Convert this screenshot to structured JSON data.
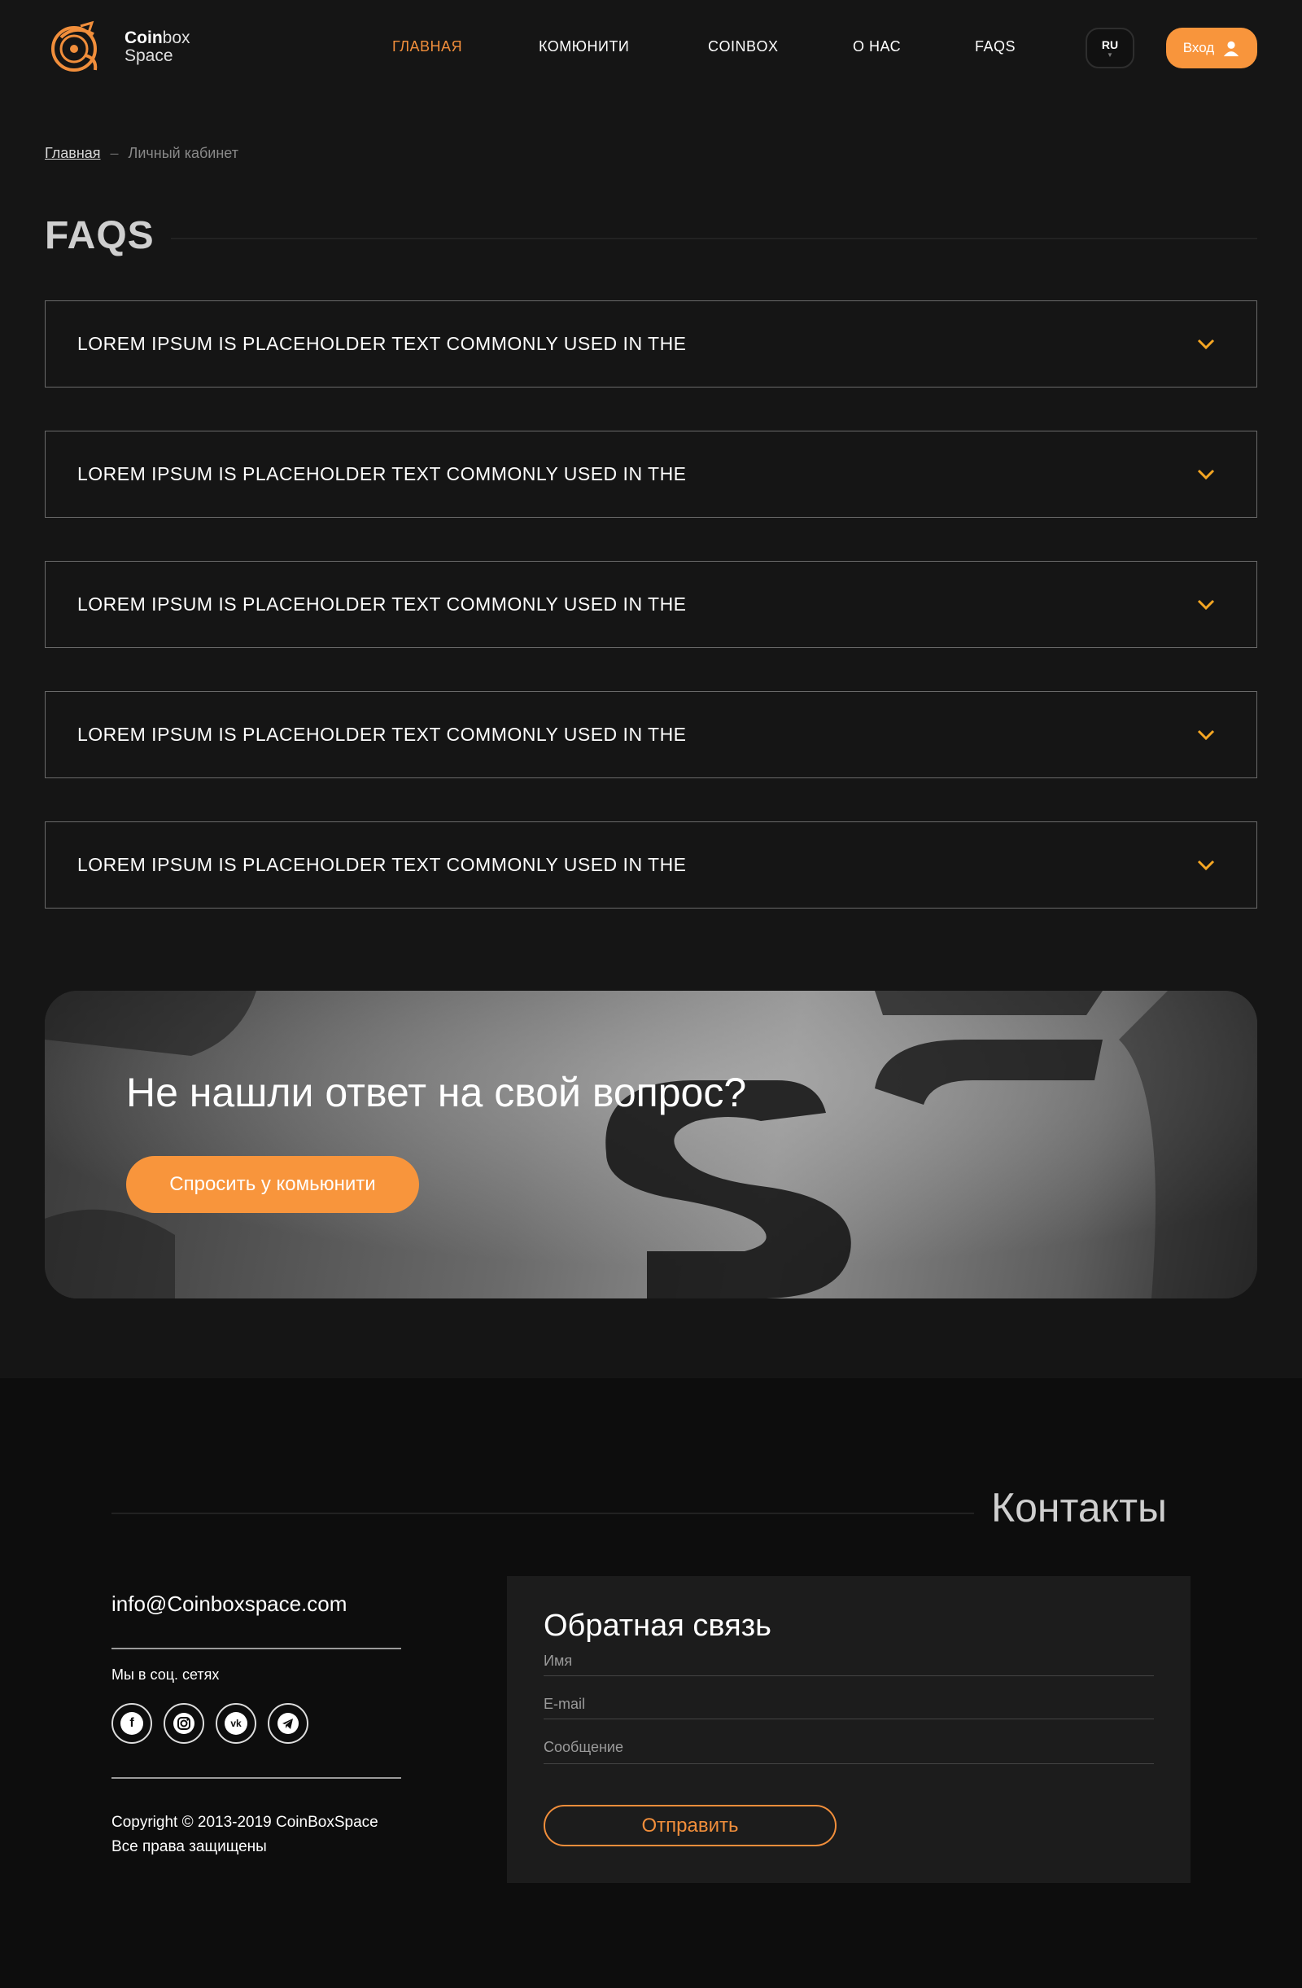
{
  "header": {
    "logo": {
      "line1_bold": "Coin",
      "line1_rest": "box",
      "line2": "Space"
    },
    "nav": [
      "ГЛАВНАЯ",
      "КОМЮНИТИ",
      "COINBOX",
      "О НАС",
      "FAQS"
    ],
    "active_nav": "ГЛАВНАЯ",
    "lang": "RU",
    "login_label": "Вход"
  },
  "breadcrumb": {
    "home": "Главная",
    "separator": "–",
    "current": "Личный кабинет"
  },
  "faq": {
    "title": "FAQS",
    "items": [
      "LOREM IPSUM IS PLACEHOLDER TEXT COMMONLY USED IN THE",
      "LOREM IPSUM IS PLACEHOLDER TEXT COMMONLY USED IN THE",
      "LOREM IPSUM IS PLACEHOLDER TEXT COMMONLY USED IN THE",
      "LOREM IPSUM IS PLACEHOLDER TEXT COMMONLY USED IN THE",
      "LOREM IPSUM IS PLACEHOLDER TEXT COMMONLY USED IN THE"
    ]
  },
  "banner": {
    "title": "Не нашли ответ на свой вопрос?",
    "button": "Спросить у комьюнити"
  },
  "footer": {
    "contacts_title": "Контакты",
    "email": "info@Coinboxspace.com",
    "social_label": "Мы в соц. сетях",
    "socials": [
      "facebook-icon",
      "instagram-icon",
      "vk-icon",
      "telegram-icon"
    ],
    "copyright_line1": "Copyright © 2013-2019 CoinBoxSpace",
    "copyright_line2": "Все права защищены"
  },
  "form": {
    "title": "Обратная связь",
    "name_placeholder": "Имя",
    "email_placeholder": "E-mail",
    "message_placeholder": "Сообщение",
    "submit": "Отправить"
  },
  "colors": {
    "accent": "#f8953c",
    "background": "#151515",
    "footer_bg": "#0d0d0d",
    "panel_bg": "#1c1c1c",
    "chevron": "#f5a623"
  }
}
